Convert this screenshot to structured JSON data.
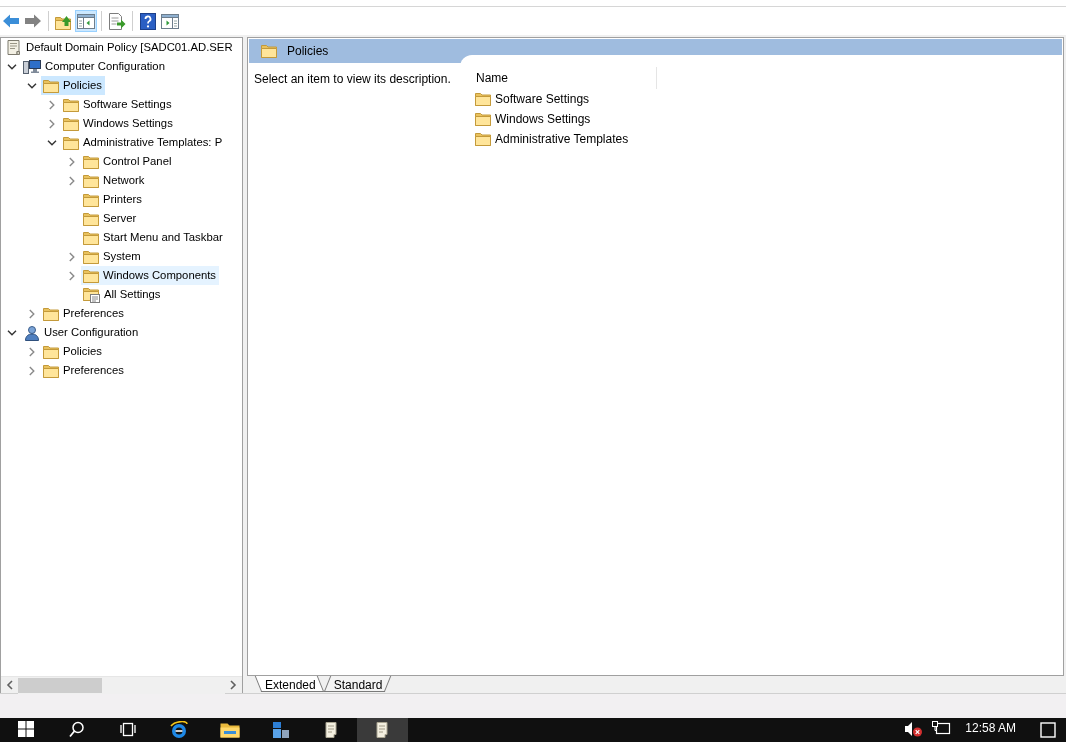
{
  "toolbar": {
    "groups": [
      {
        "buttons": [
          {
            "kind": "back",
            "pressed": false,
            "disabled": false
          },
          {
            "kind": "forward",
            "pressed": false,
            "disabled": true
          }
        ]
      },
      {
        "buttons": [
          {
            "kind": "up",
            "pressed": false,
            "disabled": false
          },
          {
            "kind": "console_tree",
            "pressed": true,
            "disabled": false
          }
        ]
      },
      {
        "buttons": [
          {
            "kind": "export",
            "pressed": false,
            "disabled": false
          }
        ]
      },
      {
        "buttons": [
          {
            "kind": "help",
            "pressed": false,
            "disabled": false
          },
          {
            "kind": "action_pane",
            "pressed": false,
            "disabled": false
          }
        ]
      }
    ]
  },
  "tree": {
    "items": [
      {
        "label": "Default Domain Policy [SADC01.AD.SER",
        "kind": "policy",
        "selected": false,
        "hovered": false,
        "children": [
          {
            "label": "Computer Configuration",
            "kind": "computer",
            "expanded": true,
            "selected": false,
            "hovered": false,
            "children": [
              {
                "label": "Policies",
                "kind": "folder",
                "expanded": true,
                "selected": true,
                "hovered": false,
                "children": [
                  {
                    "label": "Software Settings",
                    "kind": "folder",
                    "expanded": false,
                    "selected": false,
                    "hovered": false
                  },
                  {
                    "label": "Windows Settings",
                    "kind": "folder",
                    "expanded": false,
                    "selected": false,
                    "hovered": false
                  },
                  {
                    "label": "Administrative Templates: P",
                    "kind": "folder",
                    "expanded": true,
                    "selected": false,
                    "hovered": false,
                    "children": [
                      {
                        "label": "Control Panel",
                        "kind": "folder",
                        "expanded": false,
                        "selected": false,
                        "hovered": false
                      },
                      {
                        "label": "Network",
                        "kind": "folder",
                        "expanded": false,
                        "selected": false,
                        "hovered": false
                      },
                      {
                        "label": "Printers",
                        "kind": "folder",
                        "selected": false,
                        "hovered": false
                      },
                      {
                        "label": "Server",
                        "kind": "folder",
                        "selected": false,
                        "hovered": false
                      },
                      {
                        "label": "Start Menu and Taskbar",
                        "kind": "folder",
                        "selected": false,
                        "hovered": false
                      },
                      {
                        "label": "System",
                        "kind": "folder",
                        "expanded": false,
                        "selected": false,
                        "hovered": false
                      },
                      {
                        "label": "Windows Components",
                        "kind": "folder",
                        "expanded": false,
                        "selected": false,
                        "hovered": true
                      },
                      {
                        "label": "All Settings",
                        "kind": "settings",
                        "selected": false,
                        "hovered": false
                      }
                    ]
                  }
                ]
              },
              {
                "label": "Preferences",
                "kind": "folder",
                "expanded": false,
                "selected": false,
                "hovered": false
              }
            ]
          },
          {
            "label": "User Configuration",
            "kind": "user",
            "expanded": true,
            "selected": false,
            "hovered": false,
            "children": [
              {
                "label": "Policies",
                "kind": "folder",
                "expanded": false,
                "selected": false,
                "hovered": false
              },
              {
                "label": "Preferences",
                "kind": "folder",
                "expanded": false,
                "selected": false,
                "hovered": false
              }
            ]
          }
        ]
      }
    ]
  },
  "details": {
    "title": "Policies",
    "description": "Select an item to view its description.",
    "columns": [
      "Name"
    ],
    "rows": [
      {
        "name": "Software Settings",
        "selected": false
      },
      {
        "name": "Windows Settings",
        "selected": false
      },
      {
        "name": "Administrative Templates",
        "selected": false
      }
    ]
  },
  "view_tabs": [
    {
      "label": "Extended",
      "selected": true
    },
    {
      "label": "Standard",
      "selected": false
    }
  ],
  "taskbar": {
    "buttons": [
      {
        "kind": "start",
        "active": false
      },
      {
        "kind": "search",
        "active": false
      },
      {
        "kind": "task_view",
        "active": false
      },
      {
        "kind": "browser",
        "active": false
      },
      {
        "kind": "explorer",
        "active": false
      },
      {
        "kind": "server",
        "active": false
      },
      {
        "kind": "document",
        "active": false
      },
      {
        "kind": "document",
        "active": true
      }
    ],
    "tray": {
      "volume_muted": true,
      "clock": "12:58 AM"
    }
  }
}
